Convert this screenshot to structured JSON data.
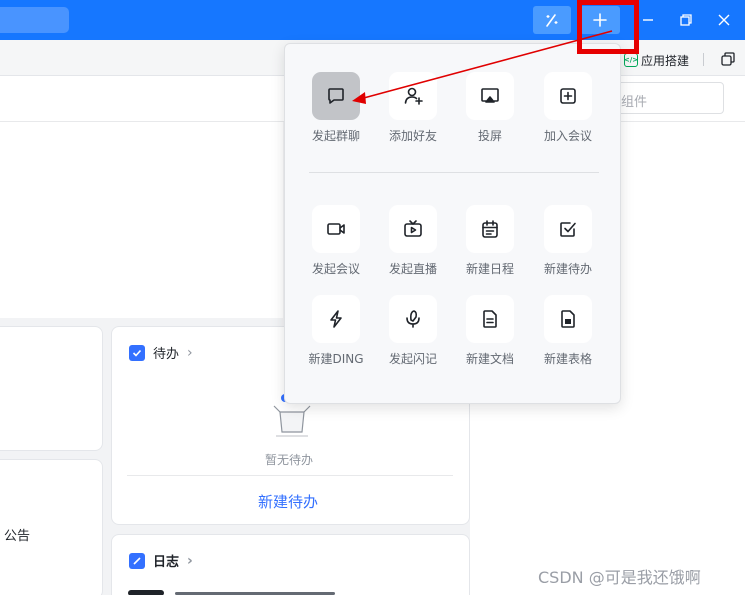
{
  "titlebar": {
    "buttons": [
      "ai-assistant",
      "plus",
      "minimize",
      "restore",
      "close"
    ]
  },
  "toolbar": {
    "app_builder_label": "应用搭建",
    "app_builder_icon_text": "</>"
  },
  "header": {
    "search_placeholder": "组件"
  },
  "quick_actions": [
    {
      "label": "发起群聊",
      "icon": "chat-bubble-icon"
    },
    {
      "label": "添加好友",
      "icon": "add-person-icon"
    },
    {
      "label": "投屏",
      "icon": "screen-cast-icon"
    },
    {
      "label": "加入会议",
      "icon": "plus-square-icon"
    },
    {
      "label": "发起会议",
      "icon": "video-camera-icon"
    },
    {
      "label": "发起直播",
      "icon": "tv-icon"
    },
    {
      "label": "新建日程",
      "icon": "calendar-icon"
    },
    {
      "label": "新建待办",
      "icon": "checkbox-icon"
    },
    {
      "label": "新建DING",
      "icon": "lightning-icon"
    },
    {
      "label": "发起闪记",
      "icon": "microphone-icon"
    },
    {
      "label": "新建文档",
      "icon": "document-icon"
    },
    {
      "label": "新建表格",
      "icon": "spreadsheet-icon"
    }
  ],
  "cards": {
    "notice_label": "公告",
    "todo": {
      "title": "待办",
      "empty_text": "暂无待办",
      "new_link": "新建待办"
    },
    "log": {
      "title": "日志"
    }
  },
  "colors": {
    "titlebar": "#1677ff",
    "accent": "#3370ff",
    "highlight": "#e60000"
  },
  "watermark": "CSDN @可是我还饿啊"
}
